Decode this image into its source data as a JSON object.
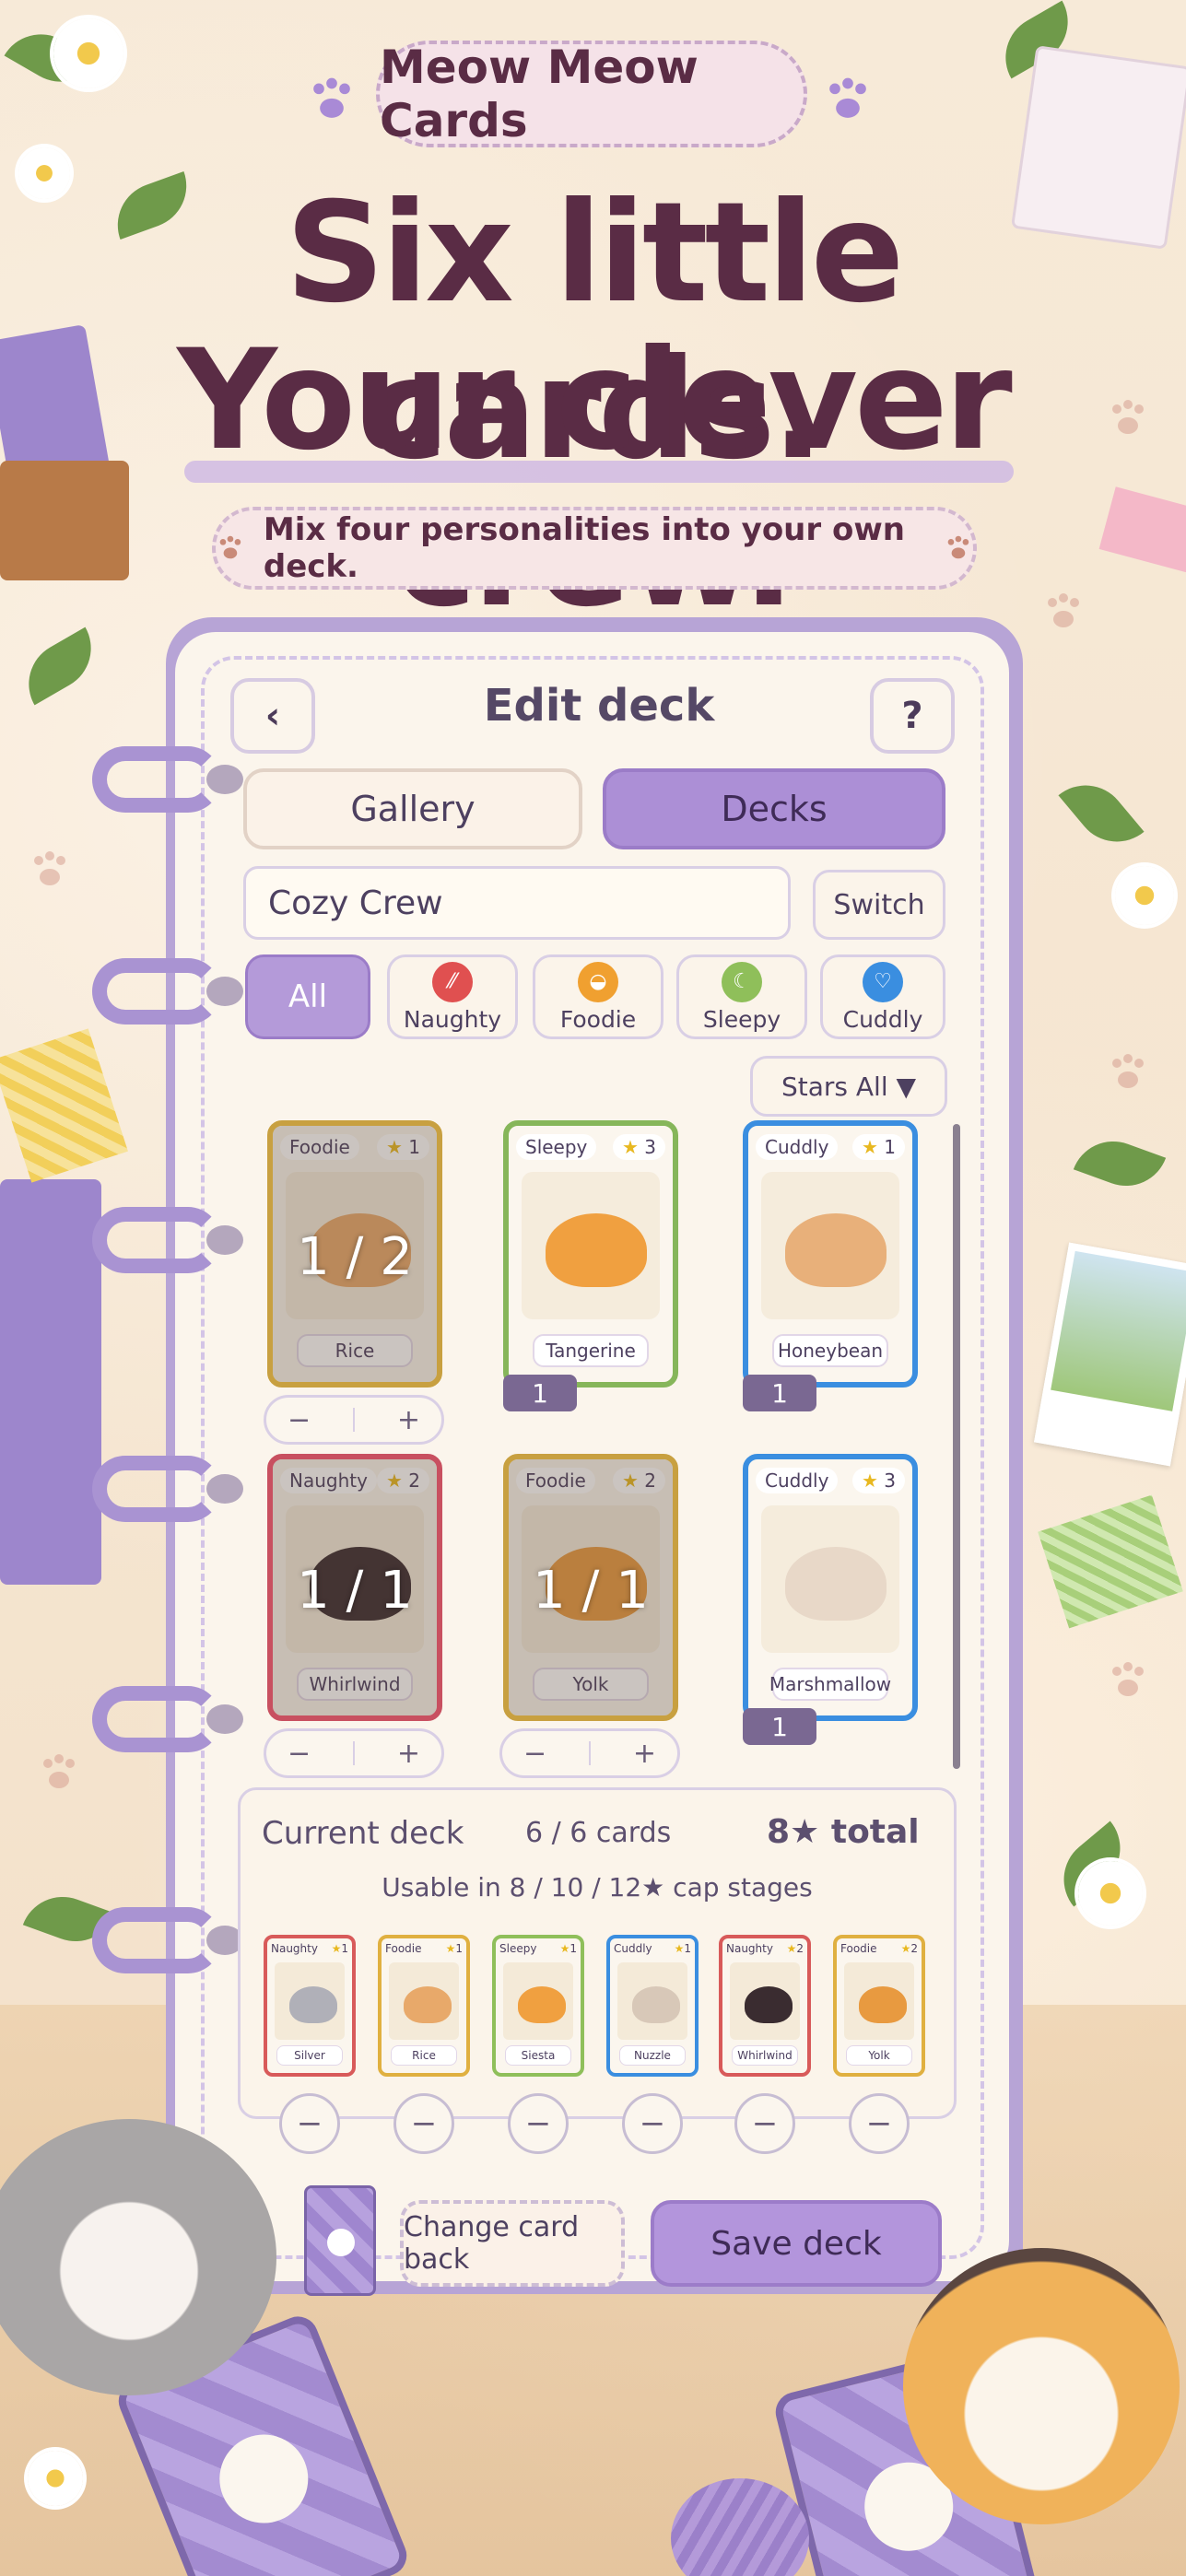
{
  "header": {
    "badge": "Meow Meow Cards",
    "headline_line1": "Six little cards.",
    "headline_line2": "Your clever crew.",
    "subtitle": "Mix four personalities into your own deck."
  },
  "topbar": {
    "back_label": "‹",
    "title": "Edit deck",
    "help_label": "?"
  },
  "tabs": [
    {
      "label": "Gallery",
      "active": false
    },
    {
      "label": "Decks",
      "active": true
    }
  ],
  "deck": {
    "name": "Cozy Crew",
    "switch_label": "Switch"
  },
  "filters": [
    {
      "label": "All",
      "active": true,
      "icon": "none"
    },
    {
      "label": "Naughty",
      "active": false,
      "icon": "stripes-icon",
      "color": "#e05050"
    },
    {
      "label": "Foodie",
      "active": false,
      "icon": "bowl-icon",
      "color": "#f0a030"
    },
    {
      "label": "Sleepy",
      "active": false,
      "icon": "moon-icon",
      "color": "#8fbf5a"
    },
    {
      "label": "Cuddly",
      "active": false,
      "icon": "heart-icon",
      "color": "#3a8ee0"
    }
  ],
  "stars_filter": "Stars All ▼",
  "gallery": [
    {
      "type": "Foodie",
      "stars": "1",
      "name": "Rice",
      "border": "#c8a040",
      "overlay": "1 / 2",
      "copies": "",
      "stepper": true,
      "cat_color": "#e8a96a"
    },
    {
      "type": "Sleepy",
      "stars": "3",
      "name": "Tangerine",
      "border": "#86b65a",
      "overlay": "",
      "copies": "1",
      "stepper": false,
      "cat_color": "#f0a040"
    },
    {
      "type": "Cuddly",
      "stars": "1",
      "name": "Honeybean",
      "border": "#3a8ee0",
      "overlay": "",
      "copies": "1",
      "stepper": false,
      "cat_color": "#e8b07a"
    },
    {
      "type": "Naughty",
      "stars": "2",
      "name": "Whirlwind",
      "border": "#c85060",
      "overlay": "1 / 1",
      "copies": "",
      "stepper": true,
      "cat_color": "#3a2c30"
    },
    {
      "type": "Foodie",
      "stars": "2",
      "name": "Yolk",
      "border": "#c8a040",
      "overlay": "1 / 1",
      "copies": "",
      "stepper": true,
      "cat_color": "#e89a40"
    },
    {
      "type": "Cuddly",
      "stars": "3",
      "name": "Marshmallow",
      "border": "#3a8ee0",
      "overlay": "",
      "copies": "1",
      "stepper": false,
      "cat_color": "#e8d8c8"
    }
  ],
  "stepper": {
    "minus": "−",
    "plus": "+"
  },
  "current_deck": {
    "label": "Current deck",
    "count": "6 / 6 cards",
    "total": "8★ total",
    "usable": "Usable in 8 / 10 / 12★ cap stages",
    "cards": [
      {
        "type": "Naughty",
        "stars": "1",
        "name": "Silver",
        "border": "#d85a5a",
        "cat_color": "#b0b0b8"
      },
      {
        "type": "Foodie",
        "stars": "1",
        "name": "Rice",
        "border": "#e0b040",
        "cat_color": "#e8a96a"
      },
      {
        "type": "Sleepy",
        "stars": "1",
        "name": "Siesta",
        "border": "#8fbf5a",
        "cat_color": "#f0a040"
      },
      {
        "type": "Cuddly",
        "stars": "1",
        "name": "Nuzzle",
        "border": "#3a8ee0",
        "cat_color": "#d8c8b8"
      },
      {
        "type": "Naughty",
        "stars": "2",
        "name": "Whirlwind",
        "border": "#d85a5a",
        "cat_color": "#3a2c30"
      },
      {
        "type": "Foodie",
        "stars": "2",
        "name": "Yolk",
        "border": "#e0b040",
        "cat_color": "#e89a40"
      }
    ],
    "remove_label": "−"
  },
  "actions": {
    "change_back": "Change card back",
    "save": "Save deck"
  }
}
